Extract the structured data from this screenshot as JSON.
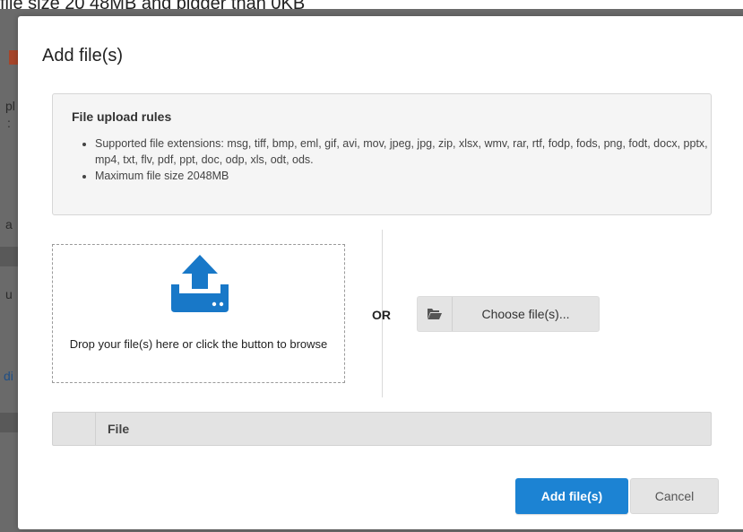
{
  "background": {
    "top_text": "file size 20 48MB and bigger than 0KB",
    "fragments": [
      "pl",
      ":",
      "a",
      "u",
      "di"
    ]
  },
  "modal": {
    "title": "Add file(s)",
    "rules": {
      "title": "File upload rules",
      "items": [
        "Supported file extensions: msg, tiff, bmp, eml, gif, avi, mov, jpeg, jpg, zip, xlsx, wmv, rar, rtf, fodp, fods, png, fodt, docx, pptx, mp4, txt, flv, pdf, ppt, doc, odp, xls, odt, ods.",
        "Maximum file size 2048MB"
      ]
    },
    "dropzone": {
      "icon": "upload-icon",
      "text": "Drop your file(s) here or click the button to browse"
    },
    "or_label": "OR",
    "choose_button": {
      "icon": "folder-open-icon",
      "label": "Choose file(s)..."
    },
    "file_table": {
      "columns": [
        "",
        "File"
      ]
    },
    "footer": {
      "primary_label": "Add file(s)",
      "cancel_label": "Cancel"
    }
  },
  "colors": {
    "primary": "#1c83d3",
    "upload_icon": "#1878c8",
    "overlay": "#6a6a6a"
  }
}
